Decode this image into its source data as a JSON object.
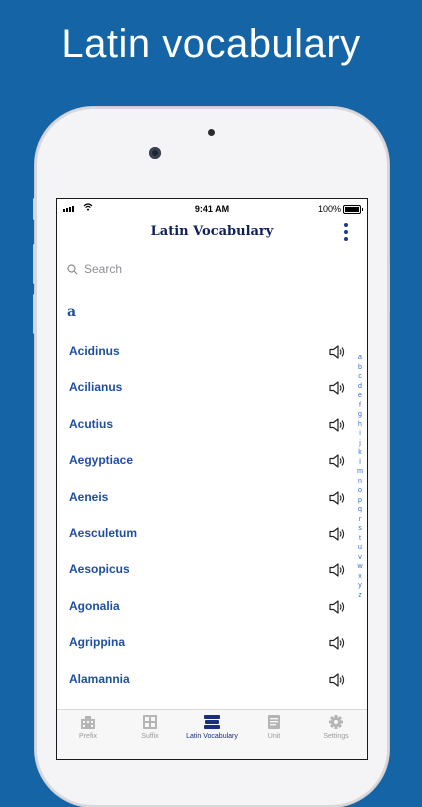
{
  "headline": "Latin vocabulary",
  "status": {
    "time": "9:41 AM",
    "battery": "100%"
  },
  "nav": {
    "title": "Latin Vocabulary"
  },
  "search": {
    "placeholder": "Search"
  },
  "section": "a",
  "words": [
    "Acidinus",
    "Acilianus",
    "Acutius",
    "Aegyptiace",
    "Aeneis",
    "Aesculetum",
    "Aesopicus",
    "Agonalia",
    "Agrippina",
    "Alamannia"
  ],
  "alphabet": [
    "a",
    "b",
    "c",
    "d",
    "e",
    "f",
    "g",
    "h",
    "i",
    "j",
    "k",
    "l",
    "m",
    "n",
    "o",
    "p",
    "q",
    "r",
    "s",
    "t",
    "u",
    "v",
    "w",
    "x",
    "y",
    "z"
  ],
  "tabs": [
    {
      "label": "Prefix",
      "icon": "building-icon"
    },
    {
      "label": "Suffix",
      "icon": "grid-icon"
    },
    {
      "label": "Latin Vocabulary",
      "icon": "books-icon",
      "active": true
    },
    {
      "label": "Unit",
      "icon": "document-icon"
    },
    {
      "label": "Settings",
      "icon": "gear-icon"
    }
  ],
  "colors": {
    "background": "#1565a6",
    "accent": "#1f4fa0",
    "nav_title": "#0f1f5c"
  }
}
